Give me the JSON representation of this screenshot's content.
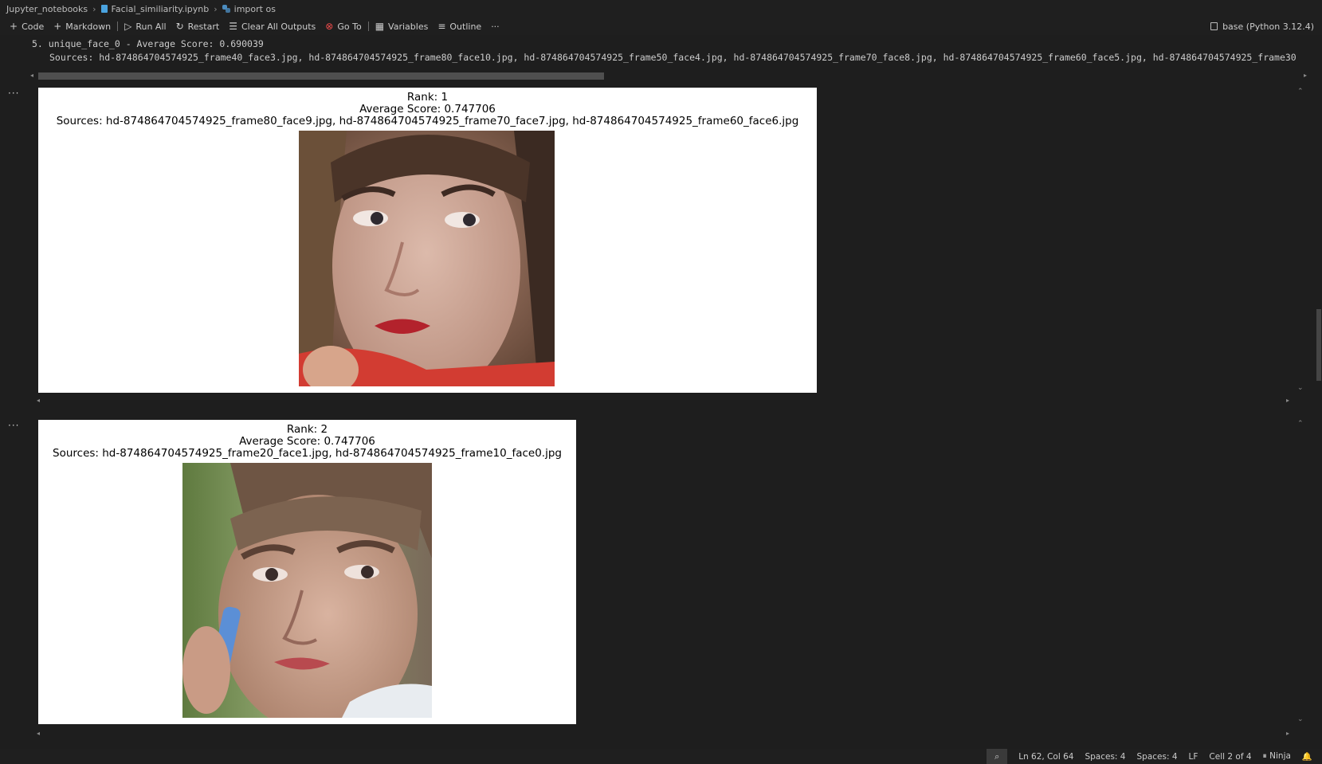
{
  "breadcrumb": {
    "folder": "Jupyter_notebooks",
    "file": "Facial_similiarity.ipynb",
    "symbol": "import os"
  },
  "toolbar": {
    "code": "Code",
    "markdown": "Markdown",
    "run_all": "Run All",
    "restart": "Restart",
    "clear_all": "Clear All Outputs",
    "goto": "Go To",
    "variables": "Variables",
    "outline": "Outline",
    "more": "···",
    "kernel": "base (Python 3.12.4)"
  },
  "text_output": {
    "line1": "5. unique_face_0 - Average Score: 0.690039",
    "line2": "Sources: hd-874864704574925_frame40_face3.jpg, hd-874864704574925_frame80_face10.jpg, hd-874864704574925_frame50_face4.jpg, hd-874864704574925_frame70_face8.jpg, hd-874864704574925_frame60_face5.jpg, hd-874864704574925_frame30"
  },
  "outputs": [
    {
      "gutter": "···",
      "rank": "Rank: 1",
      "score": "Average Score: 0.747706",
      "sources": "Sources: hd-874864704574925_frame80_face9.jpg, hd-874864704574925_frame70_face7.jpg, hd-874864704574925_frame60_face6.jpg"
    },
    {
      "gutter": "···",
      "rank": "Rank: 2",
      "score": "Average Score: 0.747706",
      "sources": "Sources: hd-874864704574925_frame20_face1.jpg, hd-874864704574925_frame10_face0.jpg"
    }
  ],
  "statusbar": {
    "position": "Ln 62, Col 64",
    "spaces_a": "Spaces: 4",
    "spaces_b": "Spaces: 4",
    "eol": "LF",
    "cell": "Cell 2 of 4",
    "keymap": "Ninja"
  }
}
